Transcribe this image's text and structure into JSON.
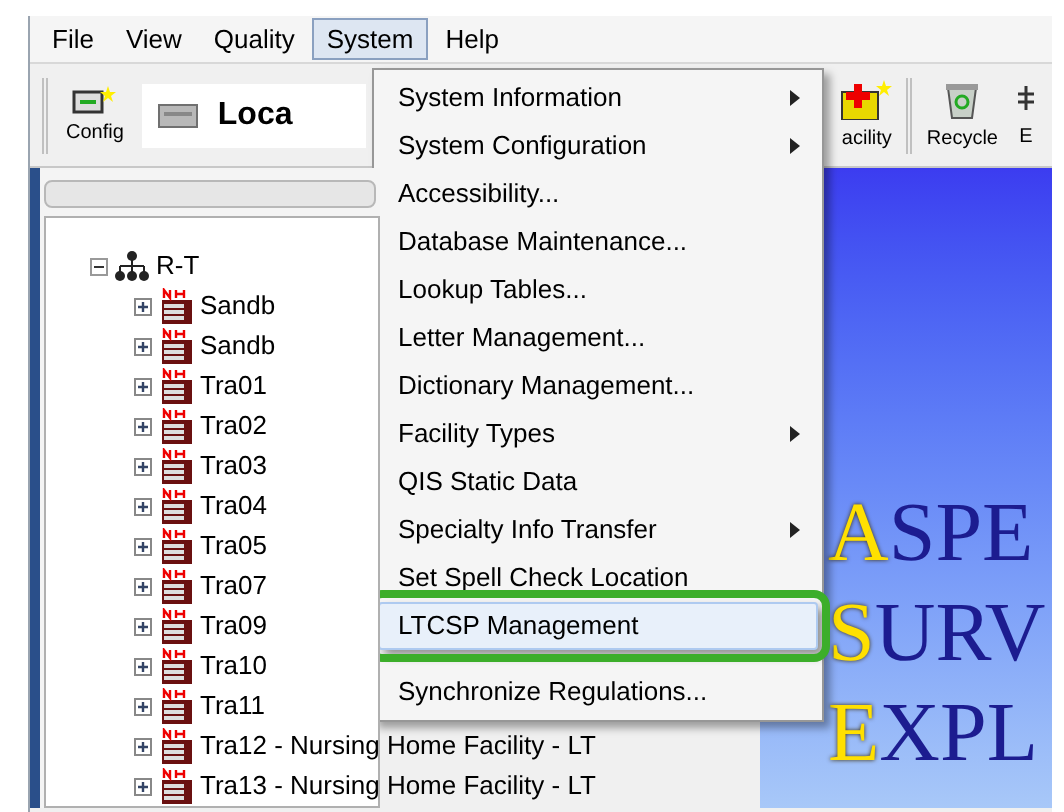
{
  "menubar": [
    {
      "label": "File",
      "selected": false
    },
    {
      "label": "View",
      "selected": false
    },
    {
      "label": "Quality",
      "selected": false
    },
    {
      "label": "System",
      "selected": true
    },
    {
      "label": "Help",
      "selected": false
    }
  ],
  "toolbar": {
    "buttons": [
      {
        "label": "Config",
        "kind": "config"
      }
    ],
    "location_field": "Loca",
    "right_buttons": [
      {
        "label": "acility",
        "kind": "facility"
      },
      {
        "label": "Recycle",
        "kind": "recycle"
      },
      {
        "label": "E",
        "kind": "partial"
      }
    ]
  },
  "tree": {
    "label": "R-T",
    "expanded": true,
    "children": [
      {
        "label": "Sandb"
      },
      {
        "label": "Sandb"
      },
      {
        "label": "Tra01"
      },
      {
        "label": "Tra02"
      },
      {
        "label": "Tra03"
      },
      {
        "label": "Tra04"
      },
      {
        "label": "Tra05"
      },
      {
        "label": "Tra07"
      },
      {
        "label": "Tra09"
      },
      {
        "label": "Tra10"
      },
      {
        "label": "Tra11"
      },
      {
        "label": "Tra12 - Nursing Home Facility - LT"
      },
      {
        "label": "Tra13 - Nursing Home Facility - LT"
      }
    ]
  },
  "system_menu": [
    {
      "label": "System Information",
      "submenu": true,
      "selected": false
    },
    {
      "label": "System Configuration",
      "submenu": true,
      "selected": false
    },
    {
      "label": "Accessibility...",
      "submenu": false,
      "selected": false
    },
    {
      "label": "Database Maintenance...",
      "submenu": false,
      "selected": false
    },
    {
      "label": "Lookup Tables...",
      "submenu": false,
      "selected": false
    },
    {
      "label": "Letter Management...",
      "submenu": false,
      "selected": false
    },
    {
      "label": "Dictionary Management...",
      "submenu": false,
      "selected": false
    },
    {
      "label": "Facility Types",
      "submenu": true,
      "selected": false
    },
    {
      "label": "QIS Static Data",
      "submenu": false,
      "selected": false
    },
    {
      "label": "Specialty Info Transfer",
      "submenu": true,
      "selected": false
    },
    {
      "label": "Set Spell Check Location",
      "submenu": false,
      "selected": false
    },
    {
      "label": "LTCSP Management",
      "submenu": false,
      "selected": true,
      "highlighted": true
    },
    {
      "kind": "separator"
    },
    {
      "label": "Synchronize Regulations...",
      "submenu": false,
      "selected": false
    }
  ],
  "splash": [
    "ASPE",
    "SURV",
    "EXPL"
  ]
}
